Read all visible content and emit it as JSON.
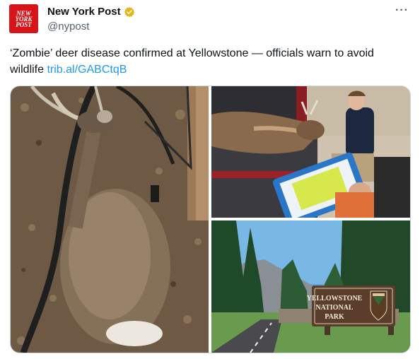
{
  "author": {
    "display_name": "New York Post",
    "handle": "@nypost",
    "avatar_text": [
      "NEW",
      "YORK",
      "POST"
    ],
    "verified_icon": "verified-badge-icon",
    "verified_color": "#e2b719"
  },
  "menu": {
    "more_label": "···"
  },
  "tweet": {
    "text": "‘Zombie’ deer disease confirmed at Yellowstone — officials warn to avoid wildlife ",
    "link": "trib.al/GABCtqB",
    "link_color": "#1d9bf0"
  },
  "media": {
    "sign_text": [
      "YELLOWSTONE",
      "NATIONAL",
      "PARK"
    ]
  }
}
